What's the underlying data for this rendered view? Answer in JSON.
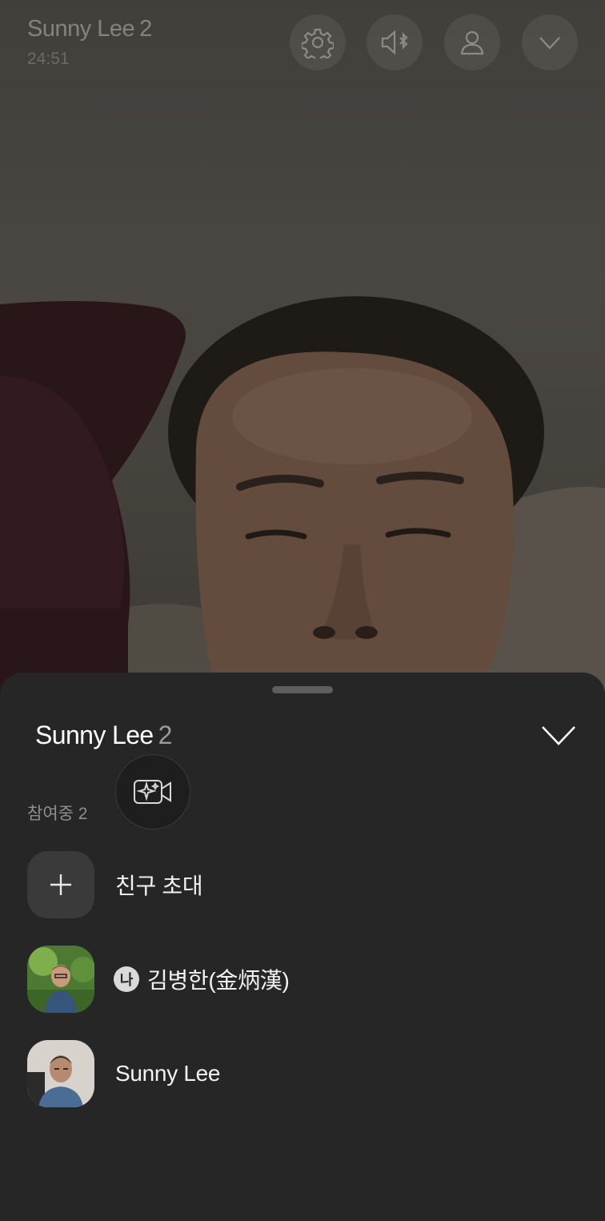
{
  "call": {
    "title": "Sunny Lee",
    "participant_count": "2",
    "timer": "24:51"
  },
  "top_controls": [
    {
      "icon": "gear-icon"
    },
    {
      "icon": "bluetooth-speaker-icon"
    },
    {
      "icon": "person-icon"
    },
    {
      "icon": "chevron-down-icon"
    }
  ],
  "sheet": {
    "title": "Sunny Lee",
    "count": "2",
    "participants_label": "참여중 2",
    "effect_icon": "camera-sparkle-icon",
    "invite_label": "친구 초대",
    "participants": [
      {
        "name": "김병한(金炳漢)",
        "badge": "나"
      },
      {
        "name": "Sunny Lee"
      }
    ]
  }
}
